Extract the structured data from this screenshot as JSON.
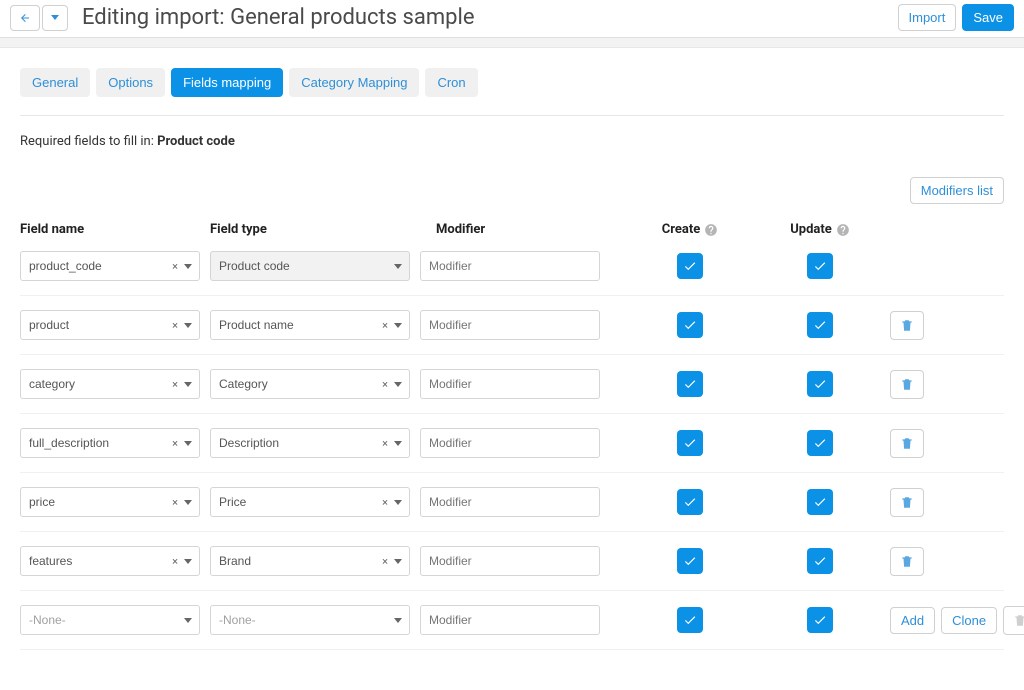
{
  "header": {
    "title": "Editing import: General products sample",
    "import_button": "Import",
    "save_button": "Save"
  },
  "tabs": {
    "general": "General",
    "options": "Options",
    "fields_mapping": "Fields mapping",
    "category_mapping": "Category Mapping",
    "cron": "Cron"
  },
  "required_line": {
    "prefix": "Required fields to fill in: ",
    "value": "Product code"
  },
  "modifiers_list_button": "Modifiers list",
  "columns": {
    "field_name": "Field name",
    "field_type": "Field type",
    "modifier": "Modifier",
    "create": "Create",
    "update": "Update"
  },
  "modifier_placeholder": "Modifier",
  "none_label": "-None-",
  "row_actions": {
    "add": "Add",
    "clone": "Clone"
  },
  "rows": [
    {
      "field_name": "product_code",
      "field_type": "Product code",
      "type_locked": true,
      "create": true,
      "update": true,
      "has_delete": false
    },
    {
      "field_name": "product",
      "field_type": "Product name",
      "type_locked": false,
      "create": true,
      "update": true,
      "has_delete": true
    },
    {
      "field_name": "category",
      "field_type": "Category",
      "type_locked": false,
      "create": true,
      "update": true,
      "has_delete": true
    },
    {
      "field_name": "full_description",
      "field_type": "Description",
      "type_locked": false,
      "create": true,
      "update": true,
      "has_delete": true
    },
    {
      "field_name": "price",
      "field_type": "Price",
      "type_locked": false,
      "create": true,
      "update": true,
      "has_delete": true
    },
    {
      "field_name": "features",
      "field_type": "Brand",
      "type_locked": false,
      "create": true,
      "update": true,
      "has_delete": true
    },
    {
      "field_name": "",
      "field_type": "",
      "type_locked": false,
      "create": true,
      "update": true,
      "has_delete": false,
      "is_new": true
    }
  ]
}
